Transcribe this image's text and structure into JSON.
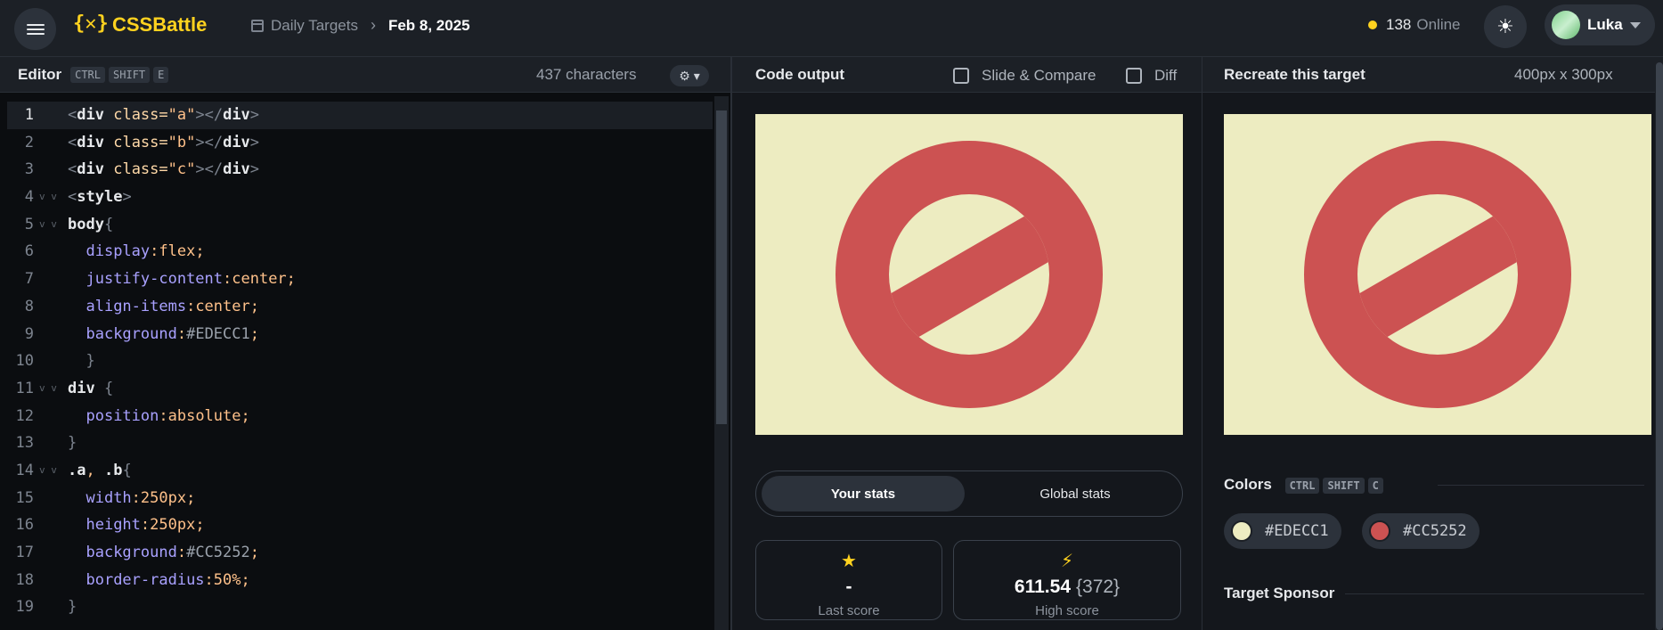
{
  "topbar": {
    "logo": "CSSBattle",
    "breadcrumb_link": "Daily Targets",
    "breadcrumb_current": "Feb 8, 2025",
    "online_count": "138",
    "online_label": "Online",
    "user_name": "Luka"
  },
  "editor": {
    "title": "Editor",
    "shortcut": [
      "CTRL",
      "SHIFT",
      "E"
    ],
    "char_count": "437 characters",
    "lines": [
      {
        "n": "1",
        "fold": ""
      },
      {
        "n": "2",
        "fold": ""
      },
      {
        "n": "3",
        "fold": ""
      },
      {
        "n": "4",
        "fold": "v v"
      },
      {
        "n": "5",
        "fold": "v v"
      },
      {
        "n": "6",
        "fold": ""
      },
      {
        "n": "7",
        "fold": ""
      },
      {
        "n": "8",
        "fold": ""
      },
      {
        "n": "9",
        "fold": ""
      },
      {
        "n": "10",
        "fold": ""
      },
      {
        "n": "11",
        "fold": "v v"
      },
      {
        "n": "12",
        "fold": ""
      },
      {
        "n": "13",
        "fold": ""
      },
      {
        "n": "14",
        "fold": "v v"
      },
      {
        "n": "15",
        "fold": ""
      },
      {
        "n": "16",
        "fold": ""
      },
      {
        "n": "17",
        "fold": ""
      },
      {
        "n": "18",
        "fold": ""
      },
      {
        "n": "19",
        "fold": ""
      }
    ]
  },
  "output": {
    "title": "Code output",
    "slide_compare_label": "Slide & Compare",
    "diff_label": "Diff",
    "tab_your": "Your stats",
    "tab_global": "Global stats",
    "last_score_value": "-",
    "last_score_label": "Last score",
    "high_score_value": "611.54",
    "high_score_chars": "{372}",
    "high_score_label": "High score"
  },
  "target": {
    "title": "Recreate this target",
    "dimensions": "400px x 300px",
    "colors_title": "Colors",
    "colors_shortcut": [
      "CTRL",
      "SHIFT",
      "C"
    ],
    "colors": [
      {
        "hex": "#EDECC1"
      },
      {
        "hex": "#CC5252"
      }
    ],
    "sponsor_title": "Target Sponsor"
  },
  "palette": {
    "background": "#EDECC1",
    "accent": "#CC5252",
    "brand": "#FFD21F"
  },
  "icons": [
    "menu-icon",
    "logo-icon",
    "calendar-icon",
    "chevron-right-icon",
    "online-dot-icon",
    "sun-icon",
    "avatar",
    "caret-down-icon",
    "gear-icon",
    "star-icon",
    "bolt-icon"
  ]
}
